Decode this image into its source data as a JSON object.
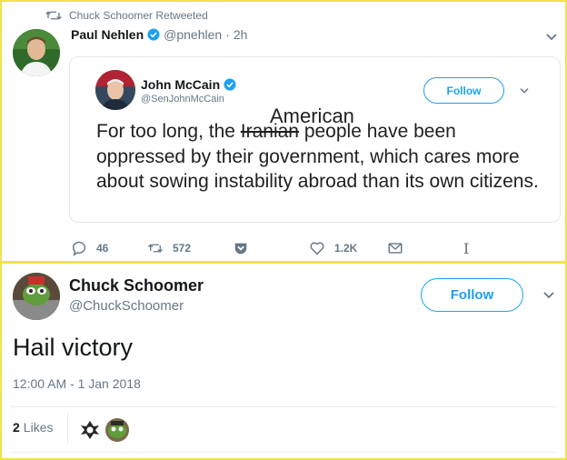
{
  "retweet_bar": {
    "text": "Chuck Schoomer Retweeted",
    "icon": "retweet-icon"
  },
  "tweet": {
    "author_name": "Paul Nehlen",
    "author_handle": "@pnehlen",
    "separator": "·",
    "time": "2h",
    "verified_icon": "verified-badge-icon",
    "quoted": {
      "author_name": "John McCain",
      "author_handle": "@SenJohnMcCain",
      "follow_label": "Follow",
      "text_prefix": "For too long, the ",
      "struck_word": "Iranian",
      "text_suffix": " people have been oppressed by their government, which cares more about sowing instability abroad than its own citizens.",
      "overwrite_word": "American"
    },
    "actions": {
      "replies": "46",
      "retweets": "572",
      "likes": "1.2K"
    }
  },
  "cursor_glyph": "I",
  "reply_tweet": {
    "author_name": "Chuck Schoomer",
    "author_handle": "@ChuckSchoomer",
    "follow_label": "Follow",
    "text": "Hail victory",
    "timestamp": "12:00 AM - 1 Jan 2018",
    "likes_count": "2",
    "likes_label": "Likes"
  },
  "colors": {
    "accent": "#1da1f2",
    "muted": "#657786",
    "border_highlight": "#f2e24a"
  }
}
